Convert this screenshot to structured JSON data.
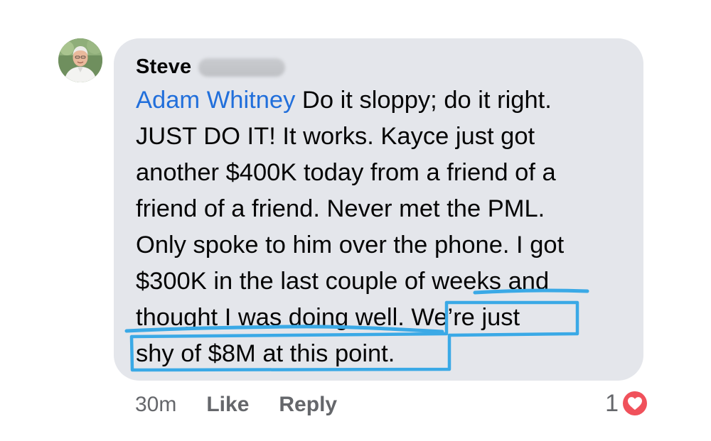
{
  "comment": {
    "author": "Steve",
    "mention": "Adam Whitney",
    "lines": [
      " Do it sloppy; do it right.",
      "JUST DO IT!  It works. Kayce just got",
      "another $400K today from a friend of a",
      "friend of a friend. Never met the PML.",
      "Only spoke to him over the phone. I got",
      "$300K in the last couple of weeks and",
      "thought I was doing well. We’re just",
      "shy of $8M at this point."
    ]
  },
  "footer": {
    "time": "30m",
    "like_label": "Like",
    "reply_label": "Reply"
  },
  "reactions": {
    "count": "1",
    "type_icon": "heart-icon"
  },
  "colors": {
    "bubble": "#e4e6eb",
    "mention": "#216fdb",
    "annotation": "#3aa9e6",
    "heart": "#f0515b",
    "meta_text": "#65676b"
  }
}
